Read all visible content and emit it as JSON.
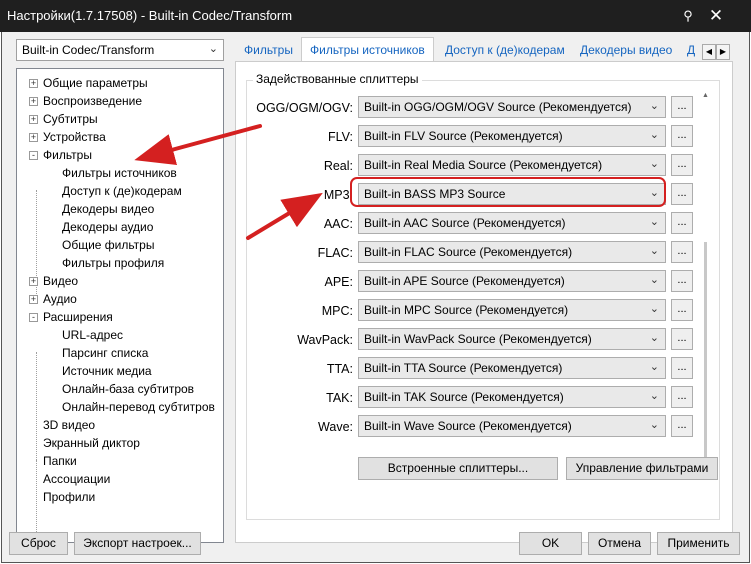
{
  "window": {
    "title": "Настройки(1.7.17508) - Built-in Codec/Transform",
    "pin_icon": "pin-icon",
    "close_icon": "close-icon"
  },
  "preset_combo": {
    "value": "Built-in Codec/Transform"
  },
  "tree": {
    "items": [
      {
        "label": "Общие параметры",
        "expander": "+"
      },
      {
        "label": "Воспроизведение",
        "expander": "+"
      },
      {
        "label": "Субтитры",
        "expander": "+"
      },
      {
        "label": "Устройства",
        "expander": "+"
      },
      {
        "label": "Фильтры",
        "expander": "-"
      },
      {
        "label": "Фильтры источников",
        "expander": ""
      },
      {
        "label": "Доступ к (де)кодерам",
        "expander": ""
      },
      {
        "label": "Декодеры видео",
        "expander": ""
      },
      {
        "label": "Декодеры аудио",
        "expander": ""
      },
      {
        "label": "Общие фильтры",
        "expander": ""
      },
      {
        "label": "Фильтры профиля",
        "expander": ""
      },
      {
        "label": "Видео",
        "expander": "+"
      },
      {
        "label": "Аудио",
        "expander": "+"
      },
      {
        "label": "Расширения",
        "expander": "-"
      },
      {
        "label": "URL-адрес",
        "expander": ""
      },
      {
        "label": "Парсинг списка",
        "expander": ""
      },
      {
        "label": "Источник медиа",
        "expander": ""
      },
      {
        "label": "Онлайн-база субтитров",
        "expander": ""
      },
      {
        "label": "Онлайн-перевод субтитров",
        "expander": ""
      },
      {
        "label": "3D видео",
        "expander": ""
      },
      {
        "label": "Экранный диктор",
        "expander": ""
      },
      {
        "label": "Папки",
        "expander": ""
      },
      {
        "label": "Ассоциации",
        "expander": ""
      },
      {
        "label": "Профили",
        "expander": ""
      }
    ]
  },
  "tabs": [
    {
      "label": "Фильтры"
    },
    {
      "label": "Фильтры источников"
    },
    {
      "label": "Доступ к (де)кодерам"
    },
    {
      "label": "Декодеры видео"
    },
    {
      "label": "Д"
    }
  ],
  "group": {
    "title": "Задействованные сплиттеры",
    "rows": [
      {
        "label": "OGG/OGM/OGV:",
        "value": "Built-in OGG/OGM/OGV Source (Рекомендуется)"
      },
      {
        "label": "FLV:",
        "value": "Built-in FLV Source (Рекомендуется)"
      },
      {
        "label": "Real:",
        "value": "Built-in Real Media Source (Рекомендуется)"
      },
      {
        "label": "MP3:",
        "value": "Built-in BASS MP3 Source"
      },
      {
        "label": "AAC:",
        "value": "Built-in AAC Source (Рекомендуется)"
      },
      {
        "label": "FLAC:",
        "value": "Built-in FLAC Source (Рекомендуется)"
      },
      {
        "label": "APE:",
        "value": "Built-in APE Source (Рекомендуется)"
      },
      {
        "label": "MPC:",
        "value": "Built-in MPC Source (Рекомендуется)"
      },
      {
        "label": "WavPack:",
        "value": "Built-in WavPack Source (Рекомендуется)"
      },
      {
        "label": "TTA:",
        "value": "Built-in TTA Source (Рекомендуется)"
      },
      {
        "label": "TAK:",
        "value": "Built-in TAK Source (Рекомендуется)"
      },
      {
        "label": "Wave:",
        "value": "Built-in Wave Source (Рекомендуется)"
      }
    ],
    "dots_label": "..."
  },
  "panel_buttons": {
    "builtin_splitters": "Встроенные сплиттеры...",
    "manage_filters": "Управление фильтрами"
  },
  "footer": {
    "reset": "Сброс",
    "export": "Экспорт настроек...",
    "ok": "OK",
    "cancel": "Отмена",
    "apply": "Применить"
  },
  "annotation_color": "#d42020"
}
